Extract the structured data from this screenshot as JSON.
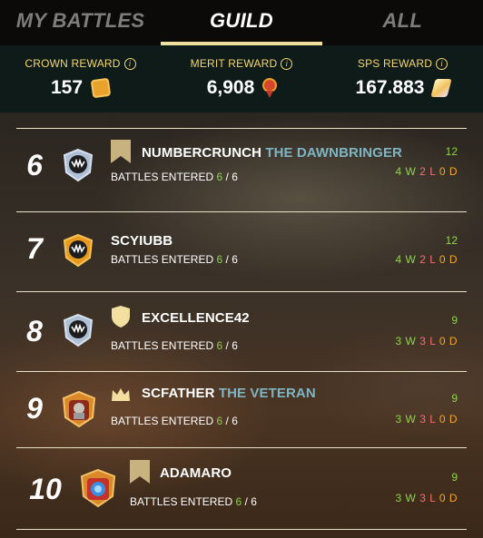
{
  "tabs": [
    {
      "label": "MY BATTLES",
      "active": false
    },
    {
      "label": "GUILD",
      "active": true
    },
    {
      "label": "ALL",
      "active": false
    }
  ],
  "rewards": [
    {
      "label": "CROWN REWARD",
      "value": "157",
      "icon": "crown-token-icon"
    },
    {
      "label": "MERIT REWARD",
      "value": "6,908",
      "icon": "merit-medal-icon"
    },
    {
      "label": "SPS REWARD",
      "value": "167.883",
      "icon": "sps-crystal-icon"
    }
  ],
  "entered_label": "BATTLES ENTERED",
  "rows": [
    {
      "rank": "6",
      "name": "NUMBERCRUNCH",
      "title": "THE DAWNBRINGER",
      "badge": "banner-icon",
      "entered": "6",
      "total": "6",
      "score": "12",
      "wins": "4 W",
      "losses": "2 L",
      "draws": "0 D"
    },
    {
      "rank": "7",
      "name": "SCYIUBB",
      "title": "",
      "badge": "",
      "entered": "6",
      "total": "6",
      "score": "12",
      "wins": "4 W",
      "losses": "2 L",
      "draws": "0 D"
    },
    {
      "rank": "8",
      "name": "EXCELLENCE42",
      "title": "",
      "badge": "shield-icon",
      "entered": "6",
      "total": "6",
      "score": "9",
      "wins": "3 W",
      "losses": "3 L",
      "draws": "0 D"
    },
    {
      "rank": "9",
      "name": "SCFATHER",
      "title": "THE VETERAN",
      "badge": "crown-icon",
      "entered": "6",
      "total": "6",
      "score": "9",
      "wins": "3 W",
      "losses": "3 L",
      "draws": "0 D"
    },
    {
      "rank": "10",
      "name": "ADAMARO",
      "title": "",
      "badge": "banner-icon",
      "entered": "6",
      "total": "6",
      "score": "9",
      "wins": "3 W",
      "losses": "3 L",
      "draws": "0 D"
    }
  ],
  "colors": {
    "accent": "#f5d76e",
    "win": "#8fd24f",
    "loss": "#ff6b6b",
    "draw": "#f5a623",
    "title": "#7fb5c2"
  }
}
